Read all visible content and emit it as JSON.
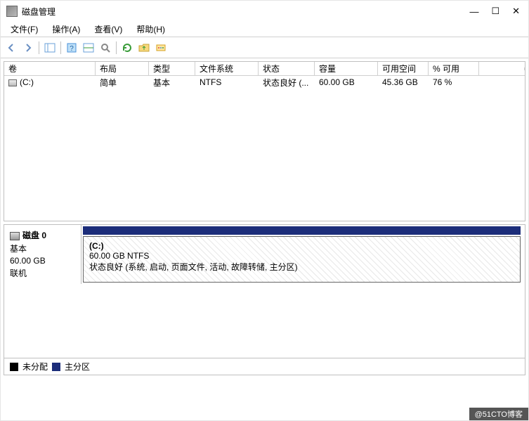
{
  "window": {
    "title": "磁盘管理",
    "min": "—",
    "max": "☐",
    "close": "✕"
  },
  "menu": {
    "file": "文件(F)",
    "action": "操作(A)",
    "view": "查看(V)",
    "help": "帮助(H)"
  },
  "toolbar_icons": {
    "back": "back-arrow-icon",
    "forward": "forward-arrow-icon",
    "tree": "tree-panel-icon",
    "help": "help-icon",
    "list": "list-panel-icon",
    "props": "properties-icon",
    "refresh": "refresh-icon",
    "folder": "folder-up-icon",
    "settings": "settings-icon"
  },
  "columns": {
    "volume": "卷",
    "layout": "布局",
    "type": "类型",
    "filesystem": "文件系统",
    "status": "状态",
    "capacity": "容量",
    "free": "可用空间",
    "pct": "% 可用"
  },
  "volumes": [
    {
      "name": "(C:)",
      "layout": "简单",
      "type": "基本",
      "filesystem": "NTFS",
      "status": "状态良好 (...",
      "capacity": "60.00 GB",
      "free": "45.36 GB",
      "pct": "76 %"
    }
  ],
  "disks": [
    {
      "name": "磁盘 0",
      "type": "基本",
      "capacity": "60.00 GB",
      "state": "联机",
      "partitions": [
        {
          "title": "(C:)",
          "info1": "60.00 GB NTFS",
          "info2": "状态良好 (系统, 启动, 页面文件, 活动, 故障转储, 主分区)"
        }
      ]
    }
  ],
  "legend": {
    "unallocated": "未分配",
    "primary": "主分区"
  },
  "watermark": "@51CTO博客"
}
